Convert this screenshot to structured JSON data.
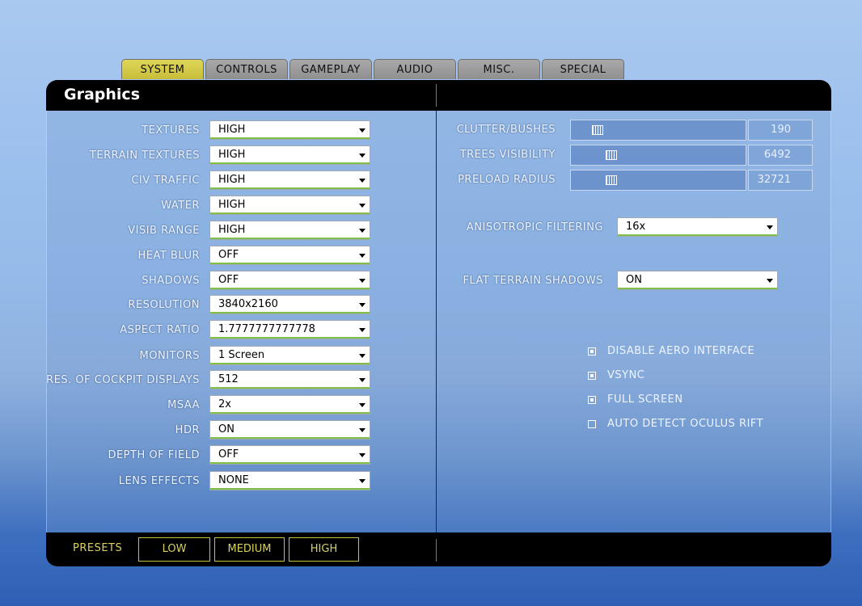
{
  "tabs": [
    {
      "label": "SYSTEM",
      "active": true
    },
    {
      "label": "CONTROLS",
      "active": false
    },
    {
      "label": "GAMEPLAY",
      "active": false
    },
    {
      "label": "AUDIO",
      "active": false
    },
    {
      "label": "MISC.",
      "active": false
    },
    {
      "label": "SPECIAL",
      "active": false
    }
  ],
  "panel": {
    "title": "Graphics"
  },
  "left_settings": [
    {
      "label": "TEXTURES",
      "value": "HIGH"
    },
    {
      "label": "TERRAIN TEXTURES",
      "value": "HIGH"
    },
    {
      "label": "CIV TRAFFIC",
      "value": "HIGH"
    },
    {
      "label": "WATER",
      "value": "HIGH"
    },
    {
      "label": "VISIB RANGE",
      "value": "HIGH"
    },
    {
      "label": "HEAT BLUR",
      "value": "OFF"
    },
    {
      "label": "SHADOWS",
      "value": "OFF"
    },
    {
      "label": "RESOLUTION",
      "value": "3840x2160"
    },
    {
      "label": "ASPECT RATIO",
      "value": "1.7777777777778"
    },
    {
      "label": "MONITORS",
      "value": "1 Screen"
    },
    {
      "label": "RES. OF COCKPIT DISPLAYS",
      "value": "512"
    },
    {
      "label": "MSAA",
      "value": "2x"
    },
    {
      "label": "HDR",
      "value": "ON"
    },
    {
      "label": "DEPTH OF FIELD",
      "value": "OFF"
    },
    {
      "label": "LENS EFFECTS",
      "value": "NONE"
    }
  ],
  "sliders": [
    {
      "label": "CLUTTER/BUSHES",
      "value": "190",
      "position_fraction": 0.1
    },
    {
      "label": "TREES VISIBILITY",
      "value": "6492",
      "position_fraction": 0.18
    },
    {
      "label": "PRELOAD RADIUS",
      "value": "32721",
      "position_fraction": 0.18
    }
  ],
  "anisotropic": {
    "label": "ANISOTROPIC FILTERING",
    "value": "16x"
  },
  "flat_shadows": {
    "label": "FLAT TERRAIN SHADOWS",
    "value": "ON"
  },
  "checkboxes": [
    {
      "label": "DISABLE AERO INTERFACE",
      "checked": true
    },
    {
      "label": "VSYNC",
      "checked": true
    },
    {
      "label": "FULL SCREEN",
      "checked": true
    },
    {
      "label": "AUTO DETECT OCULUS RIFT",
      "checked": false
    }
  ],
  "presets": {
    "label": "PRESETS",
    "buttons": [
      "LOW",
      "MEDIUM",
      "HIGH"
    ]
  },
  "colors": {
    "active_tab": "#d4ca48",
    "preset_accent": "#d9d25e",
    "header_bg": "#000000"
  }
}
